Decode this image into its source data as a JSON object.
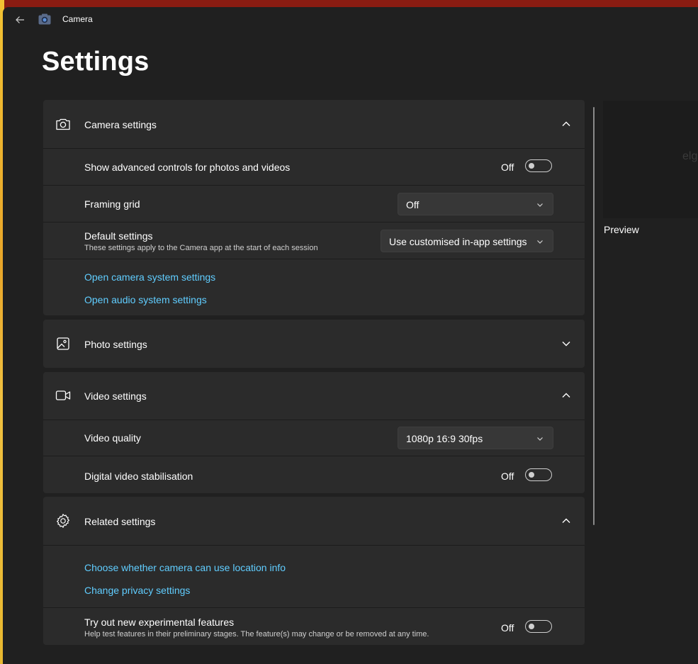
{
  "titlebar": {
    "app_title": "Camera"
  },
  "page": {
    "title": "Settings"
  },
  "camera_settings": {
    "header": "Camera settings",
    "advanced_controls": {
      "label": "Show advanced controls for photos and videos",
      "state": "Off"
    },
    "framing_grid": {
      "label": "Framing grid",
      "value": "Off"
    },
    "default_settings": {
      "label": "Default settings",
      "description": "These settings apply to the Camera app at the start of each session",
      "value": "Use customised in-app settings"
    },
    "links": [
      "Open camera system settings",
      "Open audio system settings"
    ]
  },
  "photo_settings": {
    "header": "Photo settings"
  },
  "video_settings": {
    "header": "Video settings",
    "video_quality": {
      "label": "Video quality",
      "value": "1080p 16:9 30fps"
    },
    "stabilisation": {
      "label": "Digital video stabilisation",
      "state": "Off"
    }
  },
  "related_settings": {
    "header": "Related settings",
    "links": [
      "Choose whether camera can use location info",
      "Change privacy settings"
    ],
    "experimental": {
      "label": "Try out new experimental features",
      "description": "Help test features in their preliminary stages. The feature(s) may change or be removed at any time.",
      "state": "Off"
    }
  },
  "preview": {
    "label": "Preview",
    "ghost_text": "elg"
  },
  "colors": {
    "background": "#202020",
    "card": "#2b2b2b",
    "link": "#60cdff",
    "titlebar_accent": "#8a1c12"
  }
}
